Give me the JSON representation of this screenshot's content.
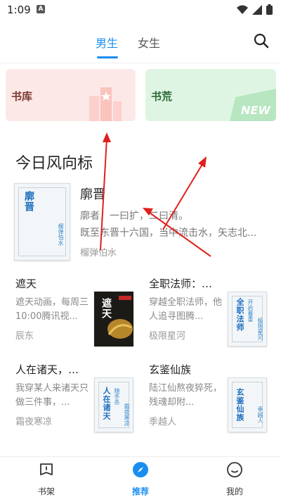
{
  "status": {
    "time": "1:09",
    "notif": "A"
  },
  "tabs": {
    "male": "男生",
    "female": "女生"
  },
  "cards": {
    "library": "书库",
    "shortage": "书荒",
    "new_badge": "NEW"
  },
  "section_title": "今日风向标",
  "featured": {
    "title": "廓晋",
    "desc1": "廓者，一曰扩，二曰清。",
    "desc2": "既至东晋十六国，当中流击水，矢志北...",
    "author": "榴弹怕水",
    "cover_title": "廓晋",
    "cover_author": "榴弹怕水"
  },
  "books": [
    {
      "title": "遮天",
      "desc": "遮天动画，每周三10:00腾讯视...",
      "author": "辰东",
      "cover_title": "遮天"
    },
    {
      "title": "全职法师：开...",
      "desc": "穿越全职法师，他人追寻图腾...",
      "author": "极限星河",
      "cover_title": "全职法师",
      "cover_sub": "开启着重",
      "cover_author": "极限星河"
    },
    {
      "title": "人在诸天，随...",
      "desc": "我穿某人来诸天只做三件事，...",
      "author": "霜夜寒凉",
      "cover_title": "人在诸天",
      "cover_sub": "随手杀",
      "cover_author": "霜夜寒凉"
    },
    {
      "title": "玄鉴仙族",
      "desc": "陆江仙熬夜猝死，残魂却附...",
      "author": "季越人",
      "cover_title": "玄鉴仙族",
      "cover_author": "季越人"
    }
  ],
  "nav": {
    "bookshelf": "书架",
    "recommend": "推荐",
    "mine": "我的"
  },
  "colors": {
    "accent": "#1a8ef0",
    "arrow": "#e0201c"
  }
}
